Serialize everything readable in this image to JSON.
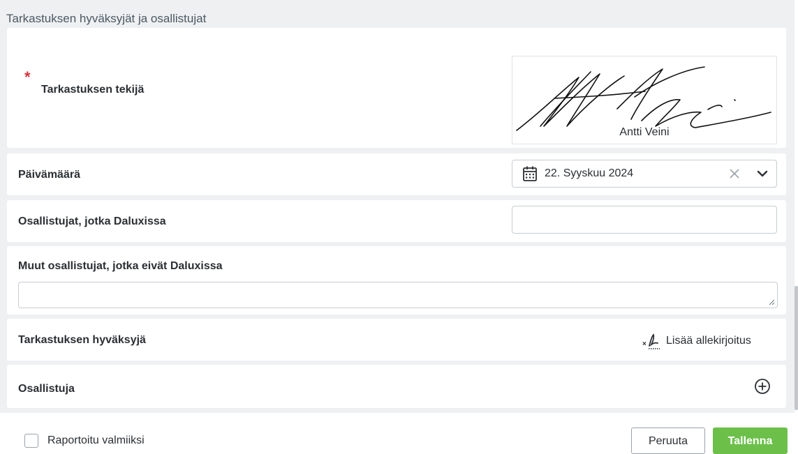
{
  "section": {
    "title": "Tarkastuksen hyväksyjät ja osallistujat"
  },
  "inspector": {
    "required_marker": "*",
    "label": "Tarkastuksen tekijä",
    "signer_name": "Antti Veini"
  },
  "date": {
    "label": "Päivämäärä",
    "value": "22. Syyskuu 2024",
    "icon": "calendar-icon"
  },
  "participants_in_dalux": {
    "label": "Osallistujat, jotka Daluxissa",
    "value": ""
  },
  "other_participants": {
    "label": "Muut osallistujat, jotka eivät Daluxissa",
    "value": ""
  },
  "approver": {
    "label": "Tarkastuksen hyväksyjä",
    "add_signature_label": "Lisää allekirjoitus",
    "icon": "signature-icon"
  },
  "participant": {
    "label": "Osallistuja",
    "icon": "plus-circle-icon"
  },
  "footer": {
    "checkbox_label": "Raportoitu valmiiksi",
    "checked": false,
    "cancel_label": "Peruuta",
    "save_label": "Tallenna"
  },
  "colors": {
    "required": "#d6323c",
    "save_button": "#6cc04a",
    "panel_background": "#eef0f2"
  }
}
